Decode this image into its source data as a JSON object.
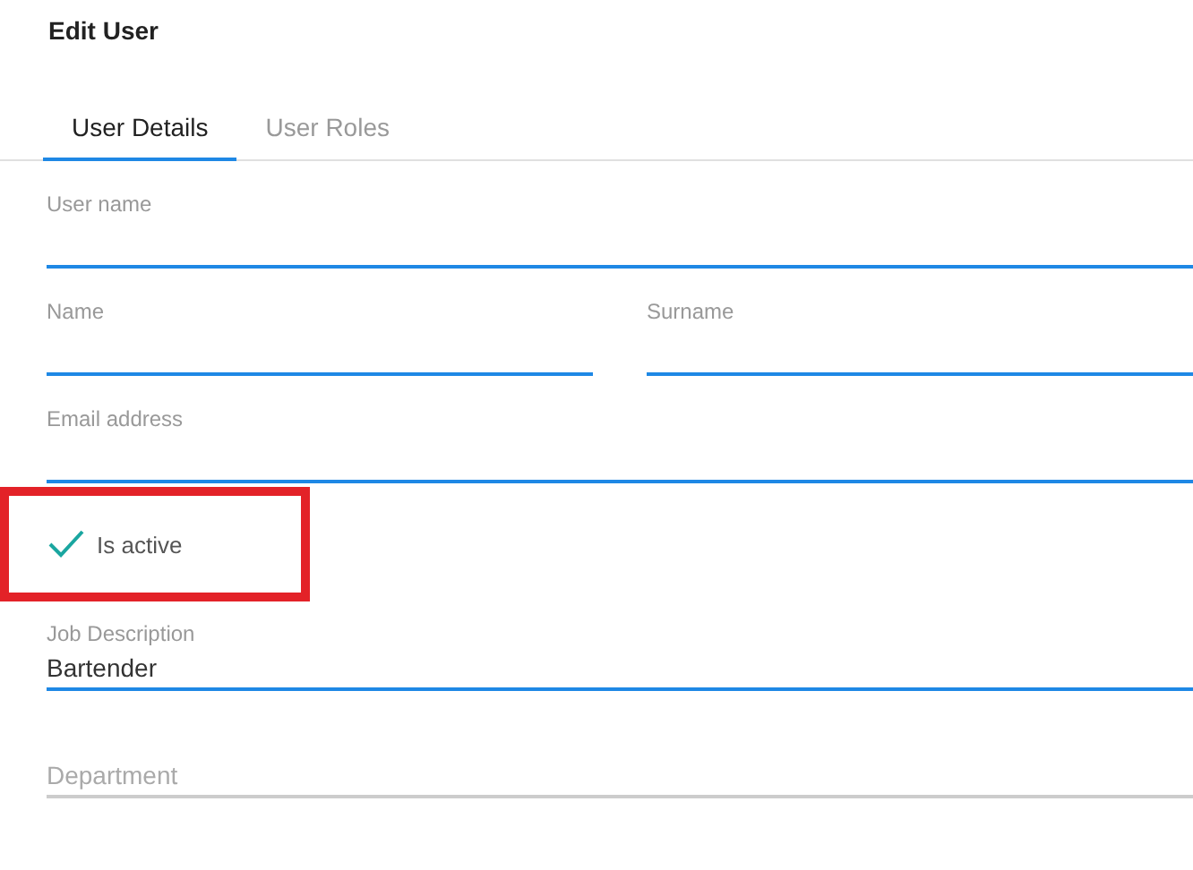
{
  "title": "Edit User",
  "tabs": [
    {
      "label": "User Details",
      "selected": true
    },
    {
      "label": "User Roles",
      "selected": false
    }
  ],
  "rows": [
    {
      "fields": [
        {
          "label": "User name",
          "highlighted": true
        }
      ]
    },
    {
      "fields": [
        {
          "label": "Name",
          "highlighted": true
        },
        {
          "label": "Surname",
          "highlighted": true
        }
      ]
    },
    {
      "fields": [
        {
          "label": "Email address",
          "highlighted": true
        }
      ]
    }
  ],
  "checkbox": {
    "label": "Is active",
    "checked": true,
    "annotated": true
  },
  "fields": [
    {
      "label": "Job Description",
      "value": "Bartender",
      "highlighted": true
    },
    {
      "placeholder": "Department",
      "highlighted": false
    }
  ]
}
